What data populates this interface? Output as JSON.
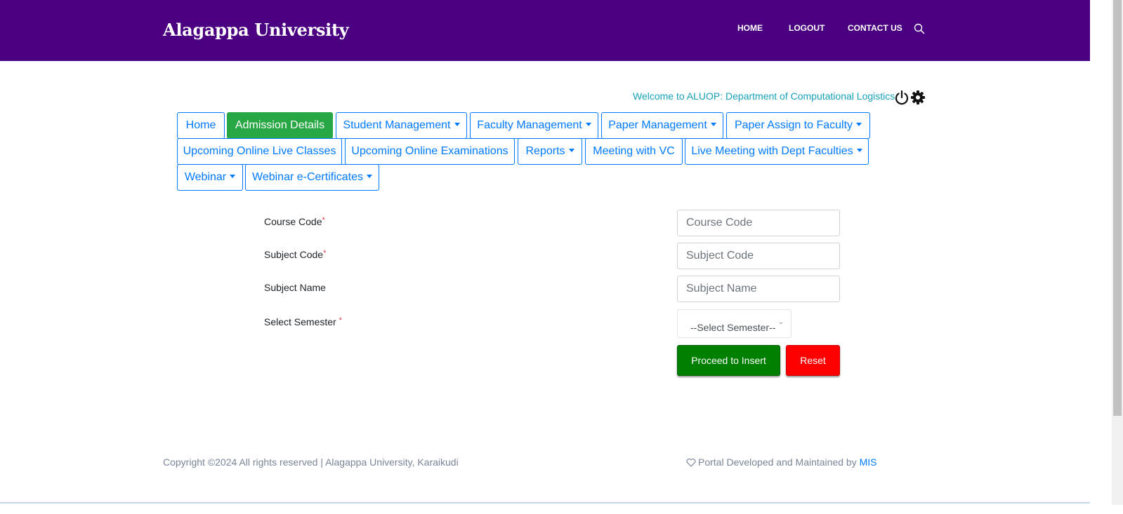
{
  "header": {
    "brand": "Alagappa University",
    "nav": [
      {
        "label": "HOME"
      },
      {
        "label": "LOGOUT"
      },
      {
        "label": "CONTACT US"
      }
    ],
    "search_icon": "search-icon"
  },
  "welcome": {
    "text": "Welcome to ALUOP: Department of Computational Logistics.",
    "icons": [
      "power-icon",
      "gear-icon"
    ]
  },
  "menu": [
    {
      "label": "Home",
      "dropdown": false,
      "active": false
    },
    {
      "label": "Admission Details",
      "dropdown": false,
      "active": true
    },
    {
      "label": "Student Management",
      "dropdown": true,
      "active": false
    },
    {
      "label": "Faculty Management",
      "dropdown": true,
      "active": false
    },
    {
      "label": "Paper Management",
      "dropdown": true,
      "active": false
    },
    {
      "label": "Paper Assign to Faculty",
      "dropdown": true,
      "active": false
    },
    {
      "label": "Upcoming Online Live Classes",
      "dropdown": false,
      "active": false
    },
    {
      "label": "Upcoming Online Examinations",
      "dropdown": false,
      "active": false
    },
    {
      "label": "Reports",
      "dropdown": true,
      "active": false
    },
    {
      "label": "Meeting with VC",
      "dropdown": false,
      "active": false
    },
    {
      "label": "Live Meeting with Dept Faculties",
      "dropdown": true,
      "active": false
    },
    {
      "label": "Webinar",
      "dropdown": true,
      "active": false
    },
    {
      "label": "Webinar e-Certificates",
      "dropdown": true,
      "active": false
    }
  ],
  "form": {
    "course_code": {
      "label": "Course Code",
      "required_mark": "*",
      "placeholder": "Course Code",
      "value": ""
    },
    "subject_code": {
      "label": "Subject Code",
      "required_mark": "*",
      "placeholder": "Subject Code",
      "value": ""
    },
    "subject_name": {
      "label": "Subject Name",
      "placeholder": "Subject Name",
      "value": ""
    },
    "semester": {
      "label": "Select Semester",
      "required_mark": "*",
      "selected": "--Select Semester--"
    },
    "insert_label": "Proceed to Insert",
    "reset_label": "Reset"
  },
  "footer": {
    "copyright": "Copyright ©2024 All rights reserved | Alagappa University, Karaikudi",
    "dev_text": "Portal Developed and Maintained by",
    "dev_link": "MIS"
  },
  "colors": {
    "header_bg": "#4b0082",
    "accent": "#007bff",
    "active_menu": "#28a745",
    "insert_button": "#008000",
    "reset_button": "#ff0000",
    "welcome_text": "#17a2b8"
  }
}
